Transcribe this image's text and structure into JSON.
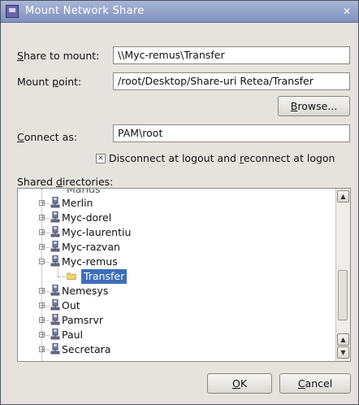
{
  "window": {
    "title": "Mount Network Share",
    "close_glyph": "✕",
    "icon": "network-share-icon"
  },
  "form": {
    "share_label": {
      "m": "S",
      "rest": "hare to mount:"
    },
    "share_value": "\\\\Myc-remus\\Transfer",
    "mount_label": {
      "pre": "Mount ",
      "m": "p",
      "rest": "oint:"
    },
    "mount_value": "/root/Desktop/Share-uri Retea/Transfer",
    "browse_label": {
      "m": "B",
      "rest": "rowse..."
    },
    "connect_label": {
      "m": "C",
      "rest": "onnect as:"
    },
    "connect_value": "PAM\\root",
    "disconnect_checked": true,
    "disconnect_label": {
      "a": "Disconnect at logout and ",
      "m": "r",
      "b": "econnect at logon"
    }
  },
  "tree": {
    "label": {
      "pre": "Shared ",
      "m": "d",
      "rest": "irectories:"
    },
    "partial_top": "Marius",
    "items": [
      {
        "label": "Merlin",
        "expanded": false
      },
      {
        "label": "Myc-dorel",
        "expanded": false
      },
      {
        "label": "Myc-laurentiu",
        "expanded": false
      },
      {
        "label": "Myc-razvan",
        "expanded": false
      },
      {
        "label": "Myc-remus",
        "expanded": true
      },
      {
        "label": "Transfer",
        "selected": true,
        "is_folder": true
      },
      {
        "label": "Nemesys",
        "expanded": false
      },
      {
        "label": "Out",
        "expanded": false
      },
      {
        "label": "Pamsrvr",
        "expanded": false
      },
      {
        "label": "Paul",
        "expanded": false
      },
      {
        "label": "Secretara",
        "expanded": false
      }
    ],
    "scroll_up_glyph": "▲",
    "scroll_down_glyph": "▼"
  },
  "buttons": {
    "ok": {
      "m": "O",
      "rest": "K"
    },
    "cancel": {
      "m": "C",
      "rest": "ancel"
    }
  },
  "colors": {
    "titlebar": "#8a9ac6",
    "selection": "#3d6eb9",
    "dialog_bg": "#e6e3df"
  }
}
